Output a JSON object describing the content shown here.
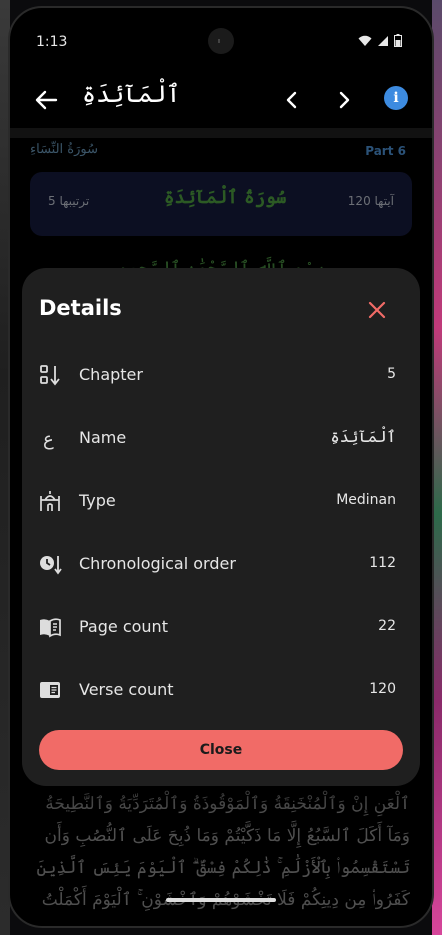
{
  "status_bar": {
    "time": "1:13"
  },
  "app_bar": {
    "title": "ٱلْمَآئِدَةِ"
  },
  "background": {
    "part_label": "Part 6",
    "previous_surah": "سُورَةُ النِّسَاءِ",
    "surah_card": {
      "left": "ترتيبها 5",
      "center": "سُورَةُ ٱلْمَآئِدَةِ",
      "right": "آيتها 120"
    },
    "bismillah": "بِسْمِ ٱللَّهِ ٱلرَّحْمَٰنِ ٱلرَّحِيمِ",
    "verse_lines": [
      "ٱلْعَنِ إِنْ وَٱلْمُنْخَنِقَةُ وَٱلْمَوْقُوذَةُ وَٱلْمُتَرَدِّيَةُ وَٱلنَّطِيحَةُ",
      "وَمَآ أَكَلَ ٱلسَّبُعُ إِلَّا مَا ذَكَّيْتُمْ وَمَا ذُبِحَ عَلَى ٱلنُّصُبِ وَأَن",
      "تَسْتَقْسِمُوا۟ بِٱلْأَزْلَٰمِ ۚ ذَٰلِكُمْ فِسْقٌ ۗ ٱلْيَوْمَ يَئِسَ ٱلَّذِينَ",
      "كَفَرُوا۟ مِن دِينِكُمْ فَلَا تَخْشَوْهُمْ وَٱخْشَوْنِ ۚ ٱلْيَوْمَ أَكْمَلْتُ"
    ]
  },
  "details": {
    "title": "Details",
    "rows": [
      {
        "icon": "chapter-number-icon",
        "label": "Chapter",
        "value": "5"
      },
      {
        "icon": "arabic-letter-icon",
        "label": "Name",
        "value": "ٱلْمَآئِدَةِ"
      },
      {
        "icon": "mosque-icon",
        "label": "Type",
        "value": "Medinan"
      },
      {
        "icon": "clock-order-icon",
        "label": "Chronological order",
        "value": "112"
      },
      {
        "icon": "open-book-icon",
        "label": "Page count",
        "value": "22"
      },
      {
        "icon": "verse-card-icon",
        "label": "Verse count",
        "value": "120"
      }
    ],
    "close_label": "Close"
  },
  "colors": {
    "accent": "#f16b67",
    "info": "#3d8be0",
    "sheet_bg": "#1f1f1f"
  }
}
